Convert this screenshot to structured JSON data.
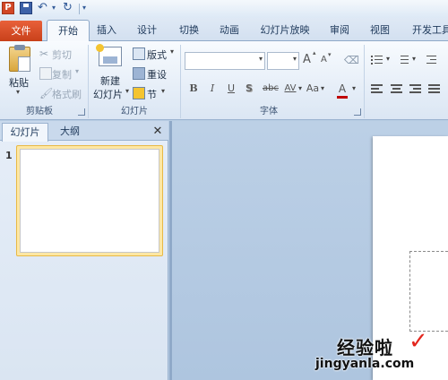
{
  "app": {
    "logo_letter": "P"
  },
  "tabs": [
    {
      "label": "文件"
    },
    {
      "label": "开始"
    },
    {
      "label": "插入"
    },
    {
      "label": "设计"
    },
    {
      "label": "切换"
    },
    {
      "label": "动画"
    },
    {
      "label": "幻灯片放映"
    },
    {
      "label": "审阅"
    },
    {
      "label": "视图"
    },
    {
      "label": "开发工具"
    }
  ],
  "ribbon": {
    "clipboard": {
      "group_label": "剪贴板",
      "paste": "粘贴",
      "cut": "剪切",
      "copy": "复制",
      "format_painter": "格式刷"
    },
    "slides": {
      "group_label": "幻灯片",
      "new_slide_line1": "新建",
      "new_slide_line2": "幻灯片",
      "layout": "版式",
      "reset": "重设",
      "section": "节"
    },
    "font": {
      "group_label": "字体",
      "font_name": "",
      "font_size": "",
      "grow": "A",
      "shrink": "A",
      "bold": "B",
      "italic": "I",
      "underline": "U",
      "shadow": "S",
      "strike": "abc",
      "spacing": "AV",
      "case": "Aa",
      "color": "A"
    }
  },
  "pane": {
    "tabs": [
      {
        "label": "幻灯片"
      },
      {
        "label": "大纲"
      }
    ],
    "close_glyph": "✕",
    "slide_number": "1"
  },
  "watermark": {
    "text": "经验啦",
    "check": "✓",
    "url": "jingyanla.com"
  },
  "colors": {
    "file_tab": "#d04c24",
    "accent_check": "#e3261d",
    "selection": "#fde7a4"
  }
}
